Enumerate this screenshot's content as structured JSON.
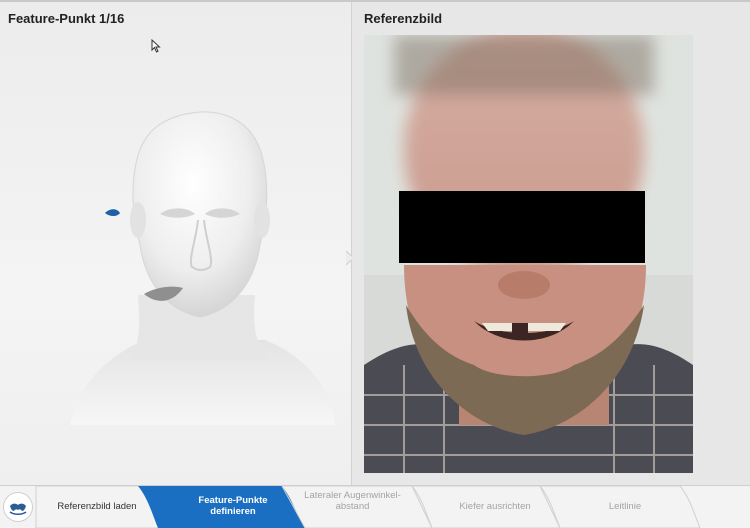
{
  "left_panel": {
    "title": "Feature-Punkt 1/16"
  },
  "right_panel": {
    "title": "Referenzbild"
  },
  "steps": [
    {
      "label": "Referenzbild laden",
      "state": "done"
    },
    {
      "label": "Feature-Punkte definieren",
      "state": "active"
    },
    {
      "label": "Lateraler Augenwinkel-abstand",
      "state": "pending"
    },
    {
      "label": "Kiefer ausrichten",
      "state": "pending"
    },
    {
      "label": "Leitlinie",
      "state": "pending"
    }
  ],
  "colors": {
    "accent": "#1a6fc2",
    "marker": "#1e5fa8"
  },
  "icons": {
    "home": "tooth-icon",
    "cursor": "mouse-cursor-icon"
  }
}
